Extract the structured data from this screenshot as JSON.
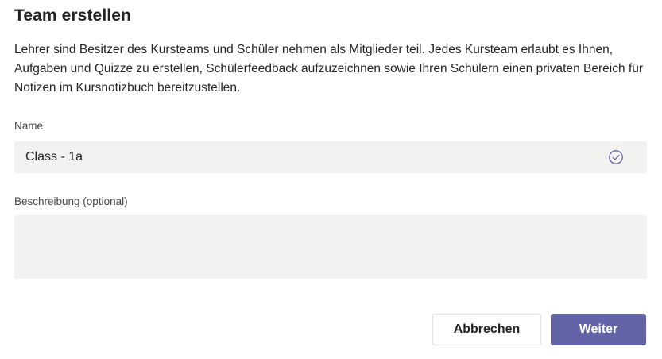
{
  "dialog": {
    "title": "Team erstellen",
    "description": "Lehrer sind Besitzer des Kursteams und Schüler nehmen als Mitglieder teil. Jedes Kursteam erlaubt es Ihnen, Aufgaben und Quizze zu erstellen, Schülerfeedback aufzuzeichnen sowie Ihren Schülern einen privaten Bereich für Notizen im Kursnotizbuch bereitzustellen."
  },
  "form": {
    "name_label": "Name",
    "name_value": "Class - 1a",
    "name_status_icon": "check-circle-icon",
    "description_label": "Beschreibung (optional)",
    "description_value": ""
  },
  "buttons": {
    "cancel_label": "Abbrechen",
    "next_label": "Weiter"
  },
  "colors": {
    "accent": "#6264a7",
    "field_background": "#f3f2f1",
    "text": "#252423"
  }
}
